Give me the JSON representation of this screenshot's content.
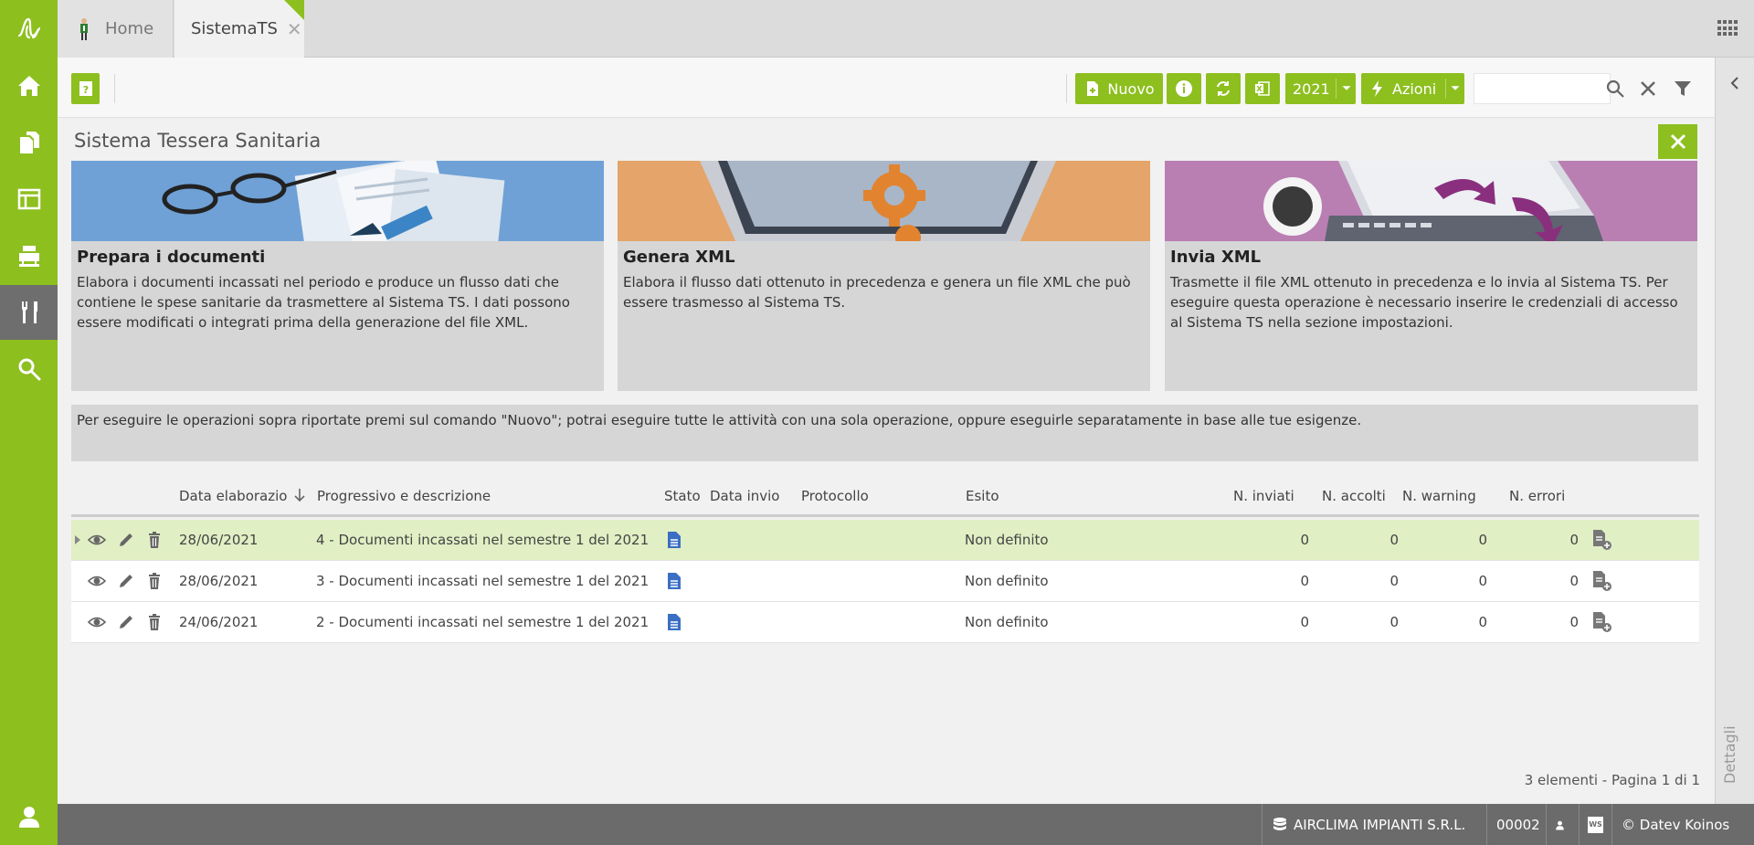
{
  "tabs": {
    "home_label": "Home",
    "active_label": "SistemaTS",
    "close_glyph": "✕"
  },
  "toolbar": {
    "nuovo_label": "Nuovo",
    "year_label": "2021",
    "azioni_label": "Azioni",
    "search_placeholder": ""
  },
  "page": {
    "title": "Sistema Tessera Sanitaria"
  },
  "cards": [
    {
      "title": "Prepara i documenti",
      "text": "Elabora i documenti incassati nel periodo e produce un flusso dati che contiene le spese sanitarie da trasmettere al Sistema TS. I dati possono essere modificati o integrati prima della generazione del file XML."
    },
    {
      "title": "Genera XML",
      "text": "Elabora il flusso dati ottenuto in precedenza e genera un file XML che può essere trasmesso al Sistema TS."
    },
    {
      "title": "Invia XML",
      "text": "Trasmette il file XML ottenuto in precedenza e lo invia al Sistema TS. Per eseguire questa operazione è necessario inserire le credenziali di accesso al Sistema TS nella sezione impostazioni."
    }
  ],
  "notice": "Per eseguire le operazioni sopra riportate premi sul comando \"Nuovo\"; potrai eseguire tutte le attività con una sola operazione, oppure eseguirle separatamente in base alle tue esigenze.",
  "table": {
    "headers": {
      "date": "Data elaborazio",
      "desc": "Progressivo e descrizione",
      "stato": "Stato",
      "data_invio": "Data invio",
      "protocollo": "Protocollo",
      "esito": "Esito",
      "inviati": "N. inviati",
      "accolti": "N. accolti",
      "warning": "N. warning",
      "errori": "N. errori"
    },
    "rows": [
      {
        "date": "28/06/2021",
        "desc": "4 - Documenti incassati nel semestre 1 del 2021",
        "esito": "Non definito",
        "inviati": "0",
        "accolti": "0",
        "warning": "0",
        "errori": "0"
      },
      {
        "date": "28/06/2021",
        "desc": "3 - Documenti incassati nel semestre 1 del 2021",
        "esito": "Non definito",
        "inviati": "0",
        "accolti": "0",
        "warning": "0",
        "errori": "0"
      },
      {
        "date": "24/06/2021",
        "desc": "2 - Documenti incassati nel semestre 1 del 2021",
        "esito": "Non definito",
        "inviati": "0",
        "accolti": "0",
        "warning": "0",
        "errori": "0"
      }
    ]
  },
  "pager": "3 elementi - Pagina 1 di 1",
  "detail_label": "Dettagli",
  "statusbar": {
    "company": "AIRCLIMA IMPIANTI S.R.L.",
    "code": "00002",
    "ws_label": "WS",
    "copyright": "© Datev Koinos"
  },
  "colors": {
    "accent": "#8dbf1f",
    "selected_row": "#e1efc4",
    "card_blue": "#6fa1d6",
    "card_orange": "#e4a46a",
    "card_purple": "#b97fb2",
    "doc_icon": "#3a6fc4"
  }
}
